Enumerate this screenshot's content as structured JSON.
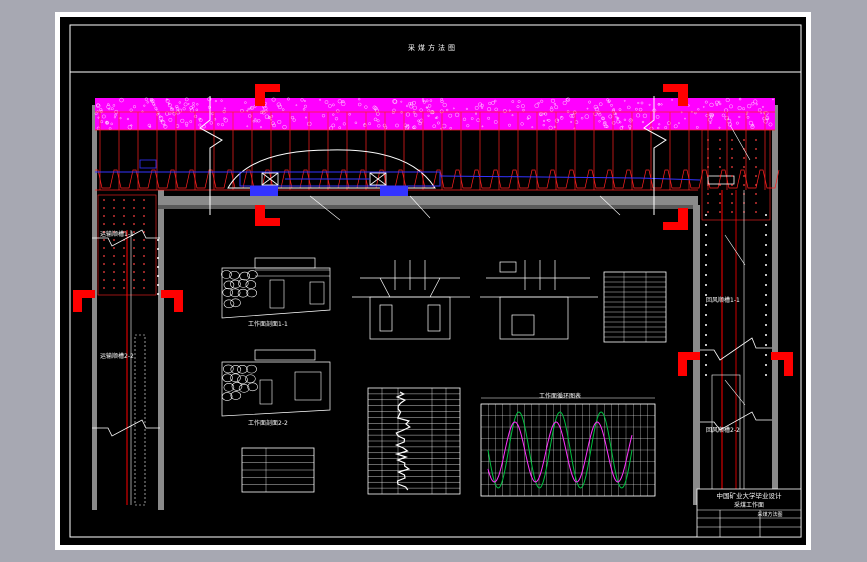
{
  "drawing": {
    "header_title": "采煤方法图",
    "colors": {
      "app_bg": "#a7a8b2",
      "paper": "#ffffff",
      "sheet": "#000000",
      "rock": "#ff00ff",
      "lines": "#ffffff",
      "support": "#ff0000",
      "conveyor": "#3333ff",
      "gray_wall": "#8a8a8a",
      "curve_green": "#00c040",
      "curve_magenta": "#ff33ff"
    },
    "labels": {
      "section_a": "工作面剖面1-1",
      "section_b": "工作面剖面2-2",
      "chart_title": "工作面循环图表",
      "roadway_left_upper": "运输顺槽1-1",
      "roadway_left_lower": "运输顺槽2-2",
      "roadway_right_upper": "回风顺槽1-1",
      "roadway_right_lower": "回风顺槽2-2"
    },
    "title_block": {
      "line1": "中国矿业大学毕业设计",
      "line2": "采煤工作面",
      "line3": "采煤方法图"
    }
  }
}
